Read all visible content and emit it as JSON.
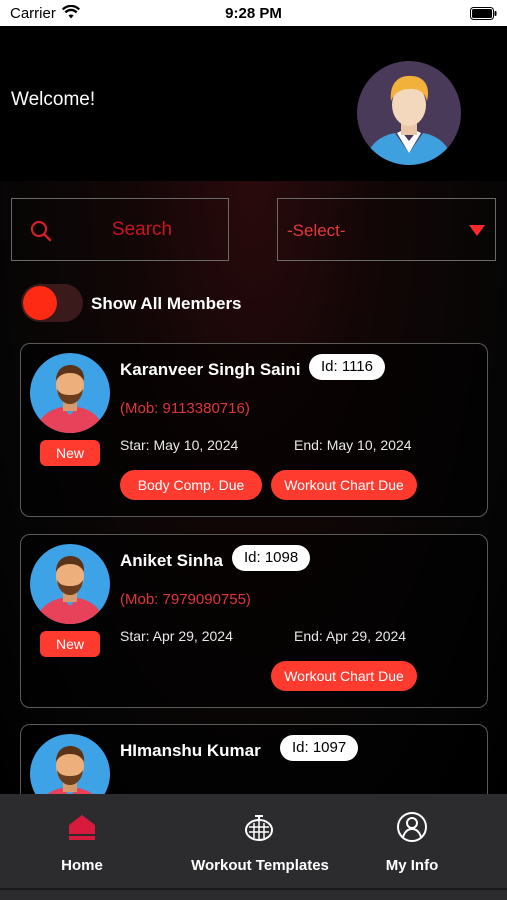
{
  "status_bar": {
    "carrier": "Carrier",
    "time": "9:28 PM"
  },
  "header": {
    "welcome": "Welcome!"
  },
  "filters": {
    "search_placeholder": "Search",
    "select_value": "-Select-",
    "toggle_label": "Show All Members",
    "toggle_on": true
  },
  "members": [
    {
      "name": "Karanveer Singh Saini",
      "id_label": "Id: 1116",
      "mobile": "(Mob: 9113380716)",
      "start": "Star: May 10, 2024",
      "end": "End: May 10, 2024",
      "badge": "New",
      "due_1": "Body Comp. Due",
      "due_2": "Workout Chart Due"
    },
    {
      "name": "Aniket Sinha",
      "id_label": "Id: 1098",
      "mobile": "(Mob: 7979090755)",
      "start": "Star: Apr 29, 2024",
      "end": "End: Apr 29, 2024",
      "badge": "New",
      "due_1": "Workout Chart Due"
    },
    {
      "name": "HImanshu Kumar",
      "id_label": "Id: 1097"
    }
  ],
  "bottom_nav": {
    "home": "Home",
    "workout_templates": "Workout Templates",
    "my_info": "My Info"
  },
  "colors": {
    "accent": "#ff3b30",
    "search_text": "#c8161d",
    "nav_background": "#2c2c2e"
  },
  "icons": [
    "wifi-icon",
    "battery-icon",
    "search-icon",
    "dropdown-icon",
    "home-icon",
    "workout-templates-icon",
    "my-info-icon"
  ]
}
